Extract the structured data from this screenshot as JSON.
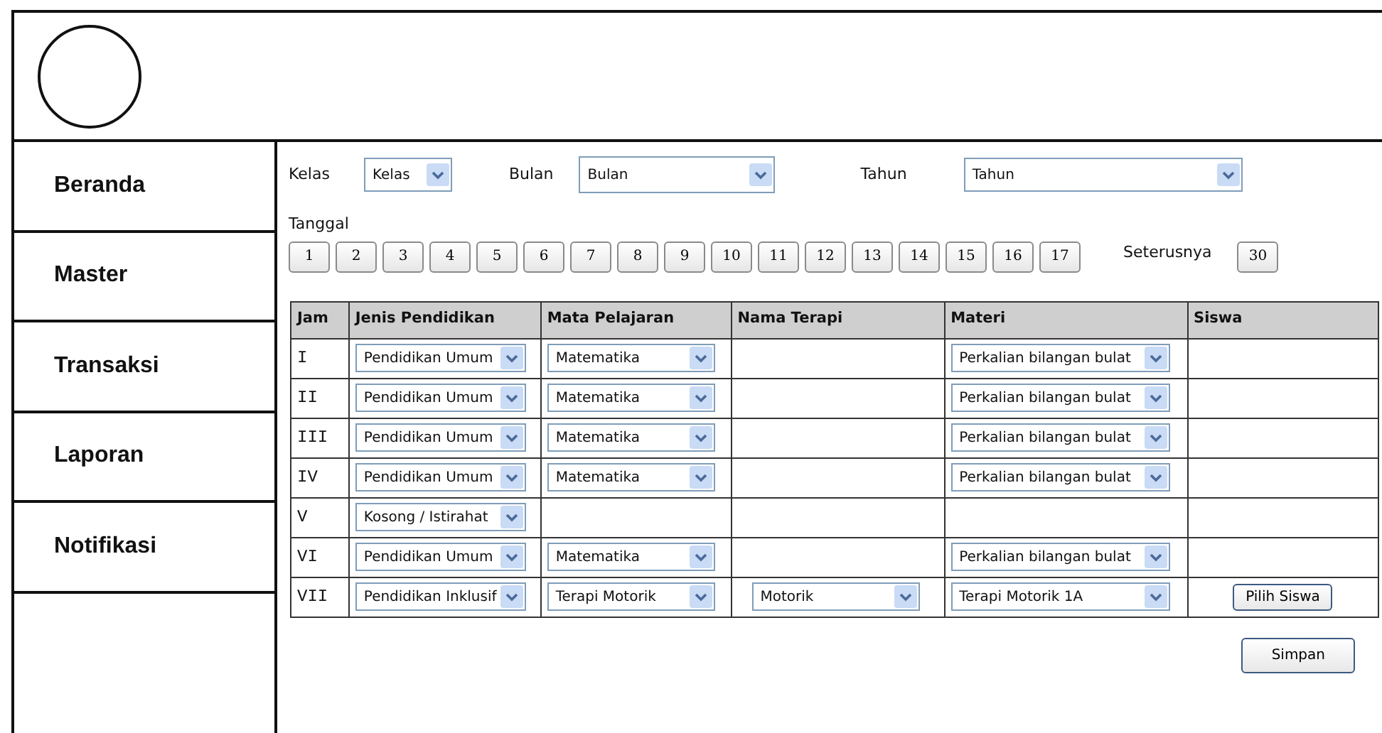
{
  "sidebar": {
    "items": [
      {
        "label": "Beranda"
      },
      {
        "label": "Master"
      },
      {
        "label": "Transaksi"
      },
      {
        "label": "Laporan"
      },
      {
        "label": "Notifikasi"
      }
    ]
  },
  "filters": [
    {
      "label": "Kelas",
      "value": "Kelas"
    },
    {
      "label": "Bulan",
      "value": "Bulan"
    },
    {
      "label": "Tahun",
      "value": "Tahun"
    }
  ],
  "dates": {
    "label": "Tanggal",
    "days": [
      "1",
      "2",
      "3",
      "4",
      "5",
      "6",
      "7",
      "8",
      "9",
      "10",
      "11",
      "12",
      "13",
      "14",
      "15",
      "16",
      "17"
    ],
    "more_label": "Seterusnya",
    "last_day": "30"
  },
  "table": {
    "columns": [
      "Jam",
      "Jenis Pendidikan",
      "Mata Pelajaran",
      "Nama Terapi",
      "Materi",
      "Siswa"
    ],
    "rows": [
      {
        "jam": "I",
        "jenis": "Pendidikan Umum",
        "mata": "Matematika",
        "materi": "Perkalian bilangan bulat"
      },
      {
        "jam": "II",
        "jenis": "Pendidikan Umum",
        "mata": "Matematika",
        "materi": "Perkalian bilangan bulat"
      },
      {
        "jam": "III",
        "jenis": "Pendidikan Umum",
        "mata": "Matematika",
        "materi": "Perkalian bilangan bulat"
      },
      {
        "jam": "IV",
        "jenis": "Pendidikan Umum",
        "mata": "Matematika",
        "materi": "Perkalian bilangan bulat"
      },
      {
        "jam": "V",
        "jenis": "Kosong / Istirahat"
      },
      {
        "jam": "VI",
        "jenis": "Pendidikan Umum",
        "mata": "Matematika",
        "materi": "Perkalian bilangan bulat"
      },
      {
        "jam": "VII",
        "jenis": "Pendidikan Inklusif",
        "mata": "Terapi Motorik",
        "nama_terapi": "Motorik",
        "materi": "Terapi Motorik 1A",
        "siswa_button": "Pilih Siswa"
      }
    ]
  },
  "save_button": "Simpan"
}
